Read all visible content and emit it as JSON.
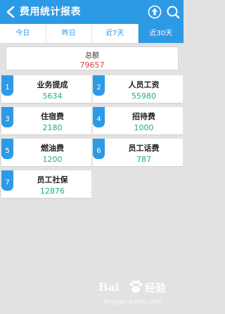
{
  "header": {
    "title": "费用统计报表",
    "accent_color": "#2d9ae6",
    "icons": {
      "back": "chevron-left-icon",
      "upload": "upload-icon",
      "search": "search-icon"
    }
  },
  "tabs": [
    {
      "label": "今日",
      "active": false
    },
    {
      "label": "昨日",
      "active": false
    },
    {
      "label": "近7天",
      "active": false
    },
    {
      "label": "近30天",
      "active": true
    }
  ],
  "summary": {
    "label": "总额",
    "value": "79657"
  },
  "categories": [
    {
      "index": "1",
      "label": "业务提成",
      "value": "5634"
    },
    {
      "index": "2",
      "label": "人员工资",
      "value": "55980"
    },
    {
      "index": "3",
      "label": "住宿费",
      "value": "2180"
    },
    {
      "index": "4",
      "label": "招待费",
      "value": "1000"
    },
    {
      "index": "5",
      "label": "燃油费",
      "value": "1200"
    },
    {
      "index": "6",
      "label": "员工话费",
      "value": "787"
    },
    {
      "index": "7",
      "label": "员工社保",
      "value": "12876"
    }
  ],
  "watermark": {
    "logo_text": "Bai",
    "jingyan": "经验",
    "url": "jingyan.baidu.com"
  }
}
